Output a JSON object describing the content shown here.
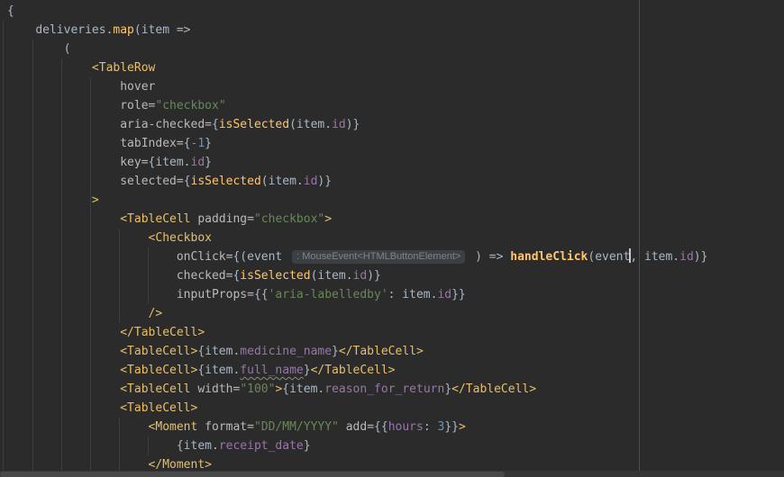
{
  "editor": {
    "background": "#2b2b2b",
    "colors": {
      "plain": "#a9b7c6",
      "tag": "#e8bf6a",
      "attr": "#bababa",
      "string": "#6a8759",
      "function": "#ffc66d",
      "field": "#9876aa",
      "number": "#6897bb",
      "hint_text": "#7e848c",
      "hint_bg": "#3d4043",
      "caret": "#c8c8c8",
      "indent_guide": "#3c3e40",
      "margin_line": "#4a4c4e",
      "scroll_track": "#333537",
      "scroll_thumb": "#47494b",
      "squiggle": "#8a8f7a"
    },
    "lines": [
      {
        "indent": 0,
        "segments": [
          {
            "t": "{",
            "s": "plain"
          }
        ]
      },
      {
        "indent": 4,
        "segments": [
          {
            "t": "deliveries.",
            "s": "plain"
          },
          {
            "t": "map",
            "s": "function"
          },
          {
            "t": "(item =>",
            "s": "plain"
          }
        ]
      },
      {
        "indent": 8,
        "segments": [
          {
            "t": "(",
            "s": "plain"
          }
        ]
      },
      {
        "indent": 12,
        "segments": [
          {
            "t": "<TableRow",
            "s": "tag"
          }
        ]
      },
      {
        "indent": 16,
        "segments": [
          {
            "t": "hover",
            "s": "attr"
          }
        ]
      },
      {
        "indent": 16,
        "segments": [
          {
            "t": "role=",
            "s": "attr"
          },
          {
            "t": "\"checkbox\"",
            "s": "string"
          }
        ]
      },
      {
        "indent": 16,
        "segments": [
          {
            "t": "aria-checked=",
            "s": "attr"
          },
          {
            "t": "{",
            "s": "plain"
          },
          {
            "t": "isSelected",
            "s": "function"
          },
          {
            "t": "(item.",
            "s": "plain"
          },
          {
            "t": "id",
            "s": "field"
          },
          {
            "t": ")}",
            "s": "plain"
          }
        ]
      },
      {
        "indent": 16,
        "segments": [
          {
            "t": "tabIndex=",
            "s": "attr"
          },
          {
            "t": "{",
            "s": "plain"
          },
          {
            "t": "-1",
            "s": "number"
          },
          {
            "t": "}",
            "s": "plain"
          }
        ]
      },
      {
        "indent": 16,
        "segments": [
          {
            "t": "key=",
            "s": "attr"
          },
          {
            "t": "{item.",
            "s": "plain"
          },
          {
            "t": "id",
            "s": "field"
          },
          {
            "t": "}",
            "s": "plain"
          }
        ]
      },
      {
        "indent": 16,
        "segments": [
          {
            "t": "selected=",
            "s": "attr"
          },
          {
            "t": "{",
            "s": "plain"
          },
          {
            "t": "isSelected",
            "s": "function"
          },
          {
            "t": "(item.",
            "s": "plain"
          },
          {
            "t": "id",
            "s": "field"
          },
          {
            "t": ")}",
            "s": "plain"
          }
        ]
      },
      {
        "indent": 12,
        "segments": [
          {
            "t": ">",
            "s": "tag"
          }
        ]
      },
      {
        "indent": 16,
        "segments": [
          {
            "t": "<TableCell",
            "s": "tag"
          },
          {
            "t": " padding=",
            "s": "attr"
          },
          {
            "t": "\"checkbox\"",
            "s": "string"
          },
          {
            "t": ">",
            "s": "tag"
          }
        ]
      },
      {
        "indent": 20,
        "segments": [
          {
            "t": "<Checkbox",
            "s": "tag"
          }
        ]
      },
      {
        "indent": 24,
        "segments": [
          {
            "t": "onClick=",
            "s": "attr"
          },
          {
            "t": "{(event ",
            "s": "plain"
          },
          {
            "type": "hint",
            "t": ": MouseEvent<HTMLButtonElement>"
          },
          {
            "t": " ) => ",
            "s": "plain"
          },
          {
            "t": "handleClick",
            "s": "function",
            "bold": true
          },
          {
            "t": "(event",
            "s": "plain"
          },
          {
            "type": "caret"
          },
          {
            "t": ", item.",
            "s": "plain"
          },
          {
            "t": "id",
            "s": "field"
          },
          {
            "t": ")}",
            "s": "plain"
          }
        ]
      },
      {
        "indent": 24,
        "segments": [
          {
            "t": "checked=",
            "s": "attr"
          },
          {
            "t": "{",
            "s": "plain"
          },
          {
            "t": "isSelected",
            "s": "function"
          },
          {
            "t": "(item.",
            "s": "plain"
          },
          {
            "t": "id",
            "s": "field"
          },
          {
            "t": ")}",
            "s": "plain"
          }
        ]
      },
      {
        "indent": 24,
        "segments": [
          {
            "t": "inputProps=",
            "s": "attr"
          },
          {
            "t": "{{",
            "s": "plain"
          },
          {
            "t": "'aria-labelledby'",
            "s": "string"
          },
          {
            "t": ": item.",
            "s": "plain"
          },
          {
            "t": "id",
            "s": "field"
          },
          {
            "t": "}}",
            "s": "plain"
          }
        ]
      },
      {
        "indent": 20,
        "segments": [
          {
            "t": "/>",
            "s": "tag"
          }
        ]
      },
      {
        "indent": 16,
        "segments": [
          {
            "t": "</TableCell>",
            "s": "tag"
          }
        ]
      },
      {
        "indent": 16,
        "segments": [
          {
            "t": "<TableCell>",
            "s": "tag"
          },
          {
            "t": "{item.",
            "s": "plain"
          },
          {
            "t": "medicine_name",
            "s": "field"
          },
          {
            "t": "}",
            "s": "plain"
          },
          {
            "t": "</TableCell>",
            "s": "tag"
          }
        ]
      },
      {
        "indent": 16,
        "segments": [
          {
            "t": "<TableCell>",
            "s": "tag"
          },
          {
            "t": "{item.",
            "s": "plain"
          },
          {
            "t": "full_name",
            "s": "field",
            "squiggle": true
          },
          {
            "t": "}",
            "s": "plain"
          },
          {
            "t": "</TableCell>",
            "s": "tag"
          }
        ]
      },
      {
        "indent": 16,
        "segments": [
          {
            "t": "<TableCell",
            "s": "tag"
          },
          {
            "t": " width=",
            "s": "attr"
          },
          {
            "t": "\"100\"",
            "s": "string"
          },
          {
            "t": ">",
            "s": "tag"
          },
          {
            "t": "{item.",
            "s": "plain"
          },
          {
            "t": "reason_for_return",
            "s": "field"
          },
          {
            "t": "}",
            "s": "plain"
          },
          {
            "t": "</TableCell>",
            "s": "tag"
          }
        ]
      },
      {
        "indent": 16,
        "segments": [
          {
            "t": "<TableCell>",
            "s": "tag"
          }
        ]
      },
      {
        "indent": 20,
        "segments": [
          {
            "t": "<Moment",
            "s": "tag"
          },
          {
            "t": " format=",
            "s": "attr"
          },
          {
            "t": "\"DD/MM/YYYY\"",
            "s": "string"
          },
          {
            "t": " add=",
            "s": "attr"
          },
          {
            "t": "{{",
            "s": "plain"
          },
          {
            "t": "hours",
            "s": "field"
          },
          {
            "t": ": ",
            "s": "plain"
          },
          {
            "t": "3",
            "s": "number"
          },
          {
            "t": "}}",
            "s": "plain"
          },
          {
            "t": ">",
            "s": "tag"
          }
        ]
      },
      {
        "indent": 24,
        "segments": [
          {
            "t": "{item.",
            "s": "plain"
          },
          {
            "t": "receipt_date",
            "s": "field"
          },
          {
            "t": "}",
            "s": "plain"
          }
        ]
      },
      {
        "indent": 20,
        "segments": [
          {
            "t": "</Moment>",
            "s": "tag"
          }
        ]
      }
    ]
  }
}
